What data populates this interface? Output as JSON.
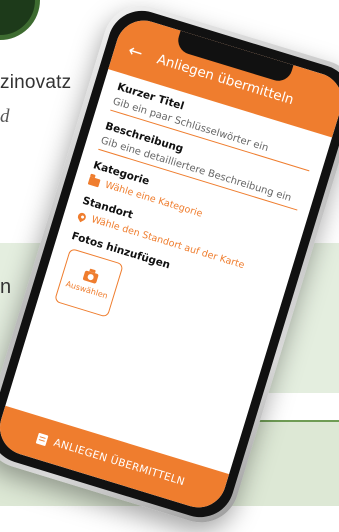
{
  "background": {
    "name_fragment": "zinovatz",
    "italic_fragment": "d",
    "panel_fragment": "n"
  },
  "colors": {
    "accent": "#ef7d2e",
    "background_green": "#e4eedf",
    "green_line": "#6f9c55"
  },
  "appbar": {
    "back_icon": "arrow-left-icon",
    "back_glyph": "←",
    "title": "Anliegen übermitteln"
  },
  "form": {
    "title_field": {
      "label": "Kurzer Titel",
      "placeholder": "Gib ein paar Schlüsselwörter ein"
    },
    "description_field": {
      "label": "Beschreibung",
      "placeholder": "Gib eine detailliertere Beschreibung ein"
    },
    "category": {
      "label": "Kategorie",
      "icon": "folder-icon",
      "action": "Wähle eine Kategorie"
    },
    "location": {
      "label": "Standort",
      "icon": "location-pin-icon",
      "action": "Wähle den Standort auf der Karte"
    },
    "photos": {
      "label": "Fotos hinzufügen",
      "icon": "camera-icon",
      "button": "Auswählen"
    }
  },
  "footer": {
    "icon": "send-icon",
    "submit_label": "ANLIEGEN ÜBERMITTELN"
  }
}
